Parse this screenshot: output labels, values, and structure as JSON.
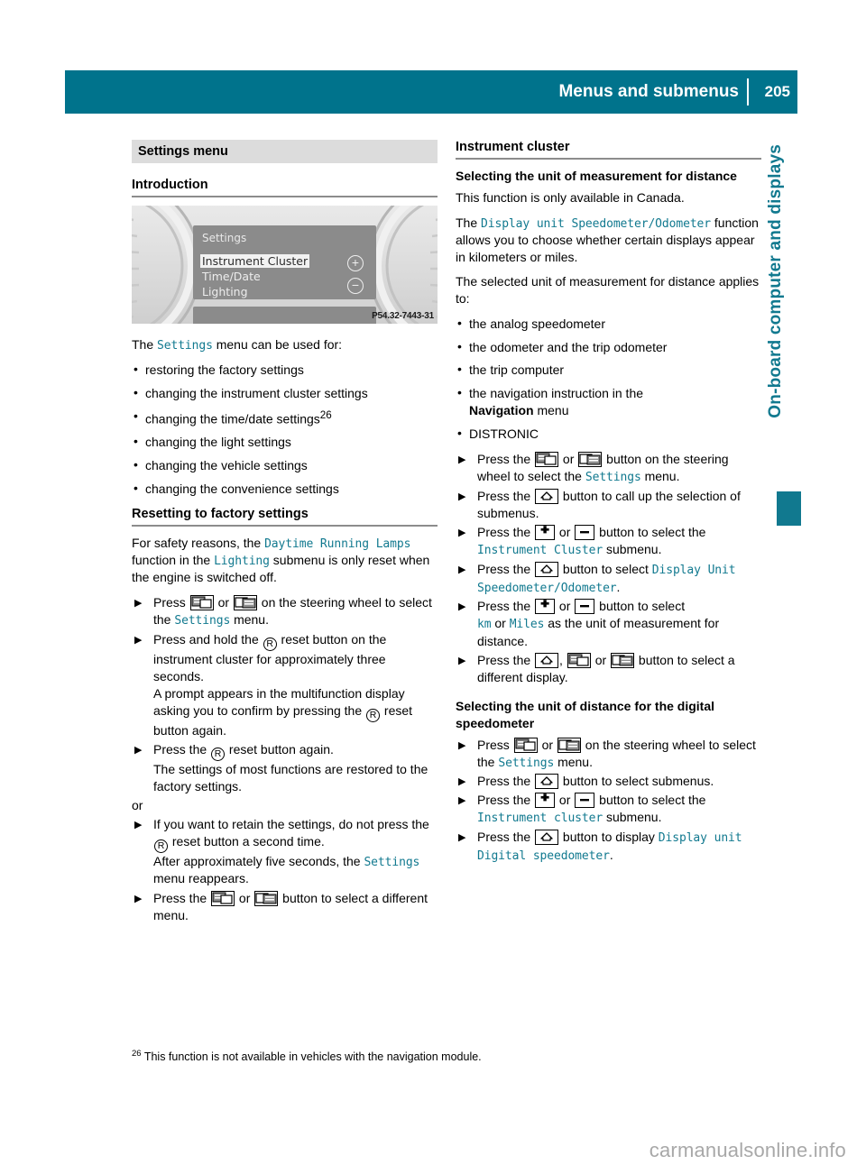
{
  "header": {
    "title": "Menus and submenus",
    "page_number": "205"
  },
  "side_tab": {
    "label": "On-board computer and displays"
  },
  "left_column": {
    "section_title": "Settings menu",
    "intro_heading": "Introduction",
    "figure": {
      "mfd_title": "Settings",
      "mfd_items": [
        "Instrument Cluster",
        "Time/Date",
        "Lighting"
      ],
      "selected_item": "Instrument Cluster",
      "plus_label": "+",
      "minus_label": "−",
      "figure_code": "P54.32-7443-31"
    },
    "intro_lead_pre": "The ",
    "intro_lead_mono": "Settings",
    "intro_lead_post": " menu can be used for:",
    "intro_bullets": [
      "restoring the factory settings",
      "changing the instrument cluster settings",
      "changing the time/date settings",
      "changing the light settings",
      "changing the vehicle settings",
      "changing the convenience settings"
    ],
    "time_date_footnote_marker": "26",
    "reset_heading": "Resetting to factory settings",
    "reset_para_1": "For safety reasons, the ",
    "reset_para_mono_1": "Daytime Running Lamps",
    "reset_para_2": " function in the ",
    "reset_para_mono_2": "Lighting",
    "reset_para_3": " submenu is only reset when the engine is switched off.",
    "step1_pre": "Press ",
    "step1_or": " or ",
    "step1_post": " on the steering wheel to select the ",
    "step1_mono": "Settings",
    "step1_end": " menu.",
    "step2_pre": "Press and hold the ",
    "step2_post": " reset button on the instrument cluster for approximately three seconds.",
    "step2_cont": "A prompt appears in the multifunction display asking you to confirm by pressing the ",
    "step2_cont_end": " reset button again.",
    "step3_pre": "Press the ",
    "step3_post": " reset button again.",
    "step3_cont": "The settings of most functions are restored to the factory settings.",
    "or_label": "or",
    "step4_pre": "If you want to retain the settings, do not press the ",
    "step4_post": " reset button a second time.",
    "step4_cont_pre": "After approximately five seconds, the ",
    "step4_cont_mono": "Settings",
    "step4_cont_post": " menu reappears.",
    "step5_pre": "Press the ",
    "step5_or": " or ",
    "step5_post": " button to select a different menu."
  },
  "right_column": {
    "section_title": "Instrument cluster",
    "heading_1": "Selecting the unit of measurement for distance",
    "para_1": "This function is only available in Canada.",
    "para_2_pre": "The ",
    "para_2_mono": "Display unit Speedometer/Odometer",
    "para_2_post": " function allows you to choose whether certain displays appear in kilometers or miles.",
    "para_3": "The selected unit of measurement for distance applies to:",
    "bullets": [
      "the analog speedometer",
      "the odometer and the trip odometer",
      "the trip computer",
      "the navigation instruction in the",
      "DISTRONIC"
    ],
    "bullet_4_bold": "Navigation",
    "bullet_4_tail": " menu",
    "s1_pre": "Press the ",
    "s1_or": " or ",
    "s1_post": " button on the steering wheel to select the ",
    "s1_mono": "Settings",
    "s1_end": " menu.",
    "s2_pre": "Press the ",
    "s2_post": " button to call up the selection of submenus.",
    "s3_pre": "Press the ",
    "s3_or": " or ",
    "s3_post": " button to select the ",
    "s3_mono": "Instrument Cluster",
    "s3_end": " submenu.",
    "s4_pre": "Press the ",
    "s4_post": " button to select ",
    "s4_mono": "Display Unit Speedometer/Odometer",
    "s4_end": ".",
    "s5_pre": "Press the ",
    "s5_or": " or ",
    "s5_post": " button to select ",
    "s5_mono_a": "km",
    "s5_mid": " or ",
    "s5_mono_b": "Miles",
    "s5_end": " as the unit of measurement for distance.",
    "s6_pre": "Press the ",
    "s6_comma": ", ",
    "s6_or": " or ",
    "s6_post": " button to select a different display.",
    "heading_2": "Selecting the unit of distance for the digital speedometer",
    "d1_pre": "Press ",
    "d1_or": " or ",
    "d1_post": " on the steering wheel to select the ",
    "d1_mono": "Settings",
    "d1_end": " menu.",
    "d2_pre": "Press the ",
    "d2_post": " button to select submenus.",
    "d3_pre": "Press the ",
    "d3_or": " or ",
    "d3_post": " button to select the ",
    "d3_mono": "Instrument cluster",
    "d3_end": " submenu.",
    "d4_pre": "Press the ",
    "d4_post": " button to display ",
    "d4_mono": "Display unit Digital speedometer",
    "d4_end": "."
  },
  "footnote": {
    "marker": "26",
    "text": "This function is not available in vehicles with the navigation module."
  },
  "watermark": {
    "text": "carmanualsonline.info"
  },
  "icons": {
    "prev_button": "mfd-prev-button-icon",
    "next_button": "mfd-next-button-icon",
    "up_button": "mfd-up-button-icon",
    "plus_button": "mfd-plus-button-icon",
    "minus_button": "mfd-minus-button-icon",
    "reset_button": "reset-r-button-icon",
    "plus_glyph": "+",
    "minus_glyph": "—",
    "reset_glyph": "R"
  },
  "colors": {
    "brand_teal": "#00738c",
    "mono_teal": "#11798f",
    "section_grey": "#dcdcdc"
  }
}
